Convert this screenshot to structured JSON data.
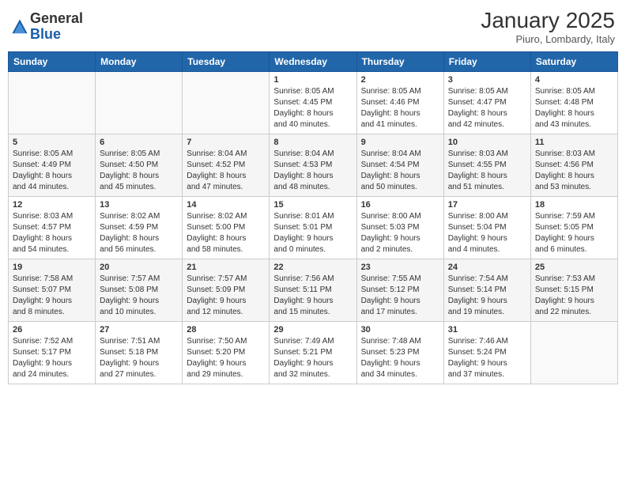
{
  "header": {
    "logo_general": "General",
    "logo_blue": "Blue",
    "month_title": "January 2025",
    "location": "Piuro, Lombardy, Italy"
  },
  "weekdays": [
    "Sunday",
    "Monday",
    "Tuesday",
    "Wednesday",
    "Thursday",
    "Friday",
    "Saturday"
  ],
  "weeks": [
    [
      {
        "day": "",
        "info": ""
      },
      {
        "day": "",
        "info": ""
      },
      {
        "day": "",
        "info": ""
      },
      {
        "day": "1",
        "info": "Sunrise: 8:05 AM\nSunset: 4:45 PM\nDaylight: 8 hours\nand 40 minutes."
      },
      {
        "day": "2",
        "info": "Sunrise: 8:05 AM\nSunset: 4:46 PM\nDaylight: 8 hours\nand 41 minutes."
      },
      {
        "day": "3",
        "info": "Sunrise: 8:05 AM\nSunset: 4:47 PM\nDaylight: 8 hours\nand 42 minutes."
      },
      {
        "day": "4",
        "info": "Sunrise: 8:05 AM\nSunset: 4:48 PM\nDaylight: 8 hours\nand 43 minutes."
      }
    ],
    [
      {
        "day": "5",
        "info": "Sunrise: 8:05 AM\nSunset: 4:49 PM\nDaylight: 8 hours\nand 44 minutes."
      },
      {
        "day": "6",
        "info": "Sunrise: 8:05 AM\nSunset: 4:50 PM\nDaylight: 8 hours\nand 45 minutes."
      },
      {
        "day": "7",
        "info": "Sunrise: 8:04 AM\nSunset: 4:52 PM\nDaylight: 8 hours\nand 47 minutes."
      },
      {
        "day": "8",
        "info": "Sunrise: 8:04 AM\nSunset: 4:53 PM\nDaylight: 8 hours\nand 48 minutes."
      },
      {
        "day": "9",
        "info": "Sunrise: 8:04 AM\nSunset: 4:54 PM\nDaylight: 8 hours\nand 50 minutes."
      },
      {
        "day": "10",
        "info": "Sunrise: 8:03 AM\nSunset: 4:55 PM\nDaylight: 8 hours\nand 51 minutes."
      },
      {
        "day": "11",
        "info": "Sunrise: 8:03 AM\nSunset: 4:56 PM\nDaylight: 8 hours\nand 53 minutes."
      }
    ],
    [
      {
        "day": "12",
        "info": "Sunrise: 8:03 AM\nSunset: 4:57 PM\nDaylight: 8 hours\nand 54 minutes."
      },
      {
        "day": "13",
        "info": "Sunrise: 8:02 AM\nSunset: 4:59 PM\nDaylight: 8 hours\nand 56 minutes."
      },
      {
        "day": "14",
        "info": "Sunrise: 8:02 AM\nSunset: 5:00 PM\nDaylight: 8 hours\nand 58 minutes."
      },
      {
        "day": "15",
        "info": "Sunrise: 8:01 AM\nSunset: 5:01 PM\nDaylight: 9 hours\nand 0 minutes."
      },
      {
        "day": "16",
        "info": "Sunrise: 8:00 AM\nSunset: 5:03 PM\nDaylight: 9 hours\nand 2 minutes."
      },
      {
        "day": "17",
        "info": "Sunrise: 8:00 AM\nSunset: 5:04 PM\nDaylight: 9 hours\nand 4 minutes."
      },
      {
        "day": "18",
        "info": "Sunrise: 7:59 AM\nSunset: 5:05 PM\nDaylight: 9 hours\nand 6 minutes."
      }
    ],
    [
      {
        "day": "19",
        "info": "Sunrise: 7:58 AM\nSunset: 5:07 PM\nDaylight: 9 hours\nand 8 minutes."
      },
      {
        "day": "20",
        "info": "Sunrise: 7:57 AM\nSunset: 5:08 PM\nDaylight: 9 hours\nand 10 minutes."
      },
      {
        "day": "21",
        "info": "Sunrise: 7:57 AM\nSunset: 5:09 PM\nDaylight: 9 hours\nand 12 minutes."
      },
      {
        "day": "22",
        "info": "Sunrise: 7:56 AM\nSunset: 5:11 PM\nDaylight: 9 hours\nand 15 minutes."
      },
      {
        "day": "23",
        "info": "Sunrise: 7:55 AM\nSunset: 5:12 PM\nDaylight: 9 hours\nand 17 minutes."
      },
      {
        "day": "24",
        "info": "Sunrise: 7:54 AM\nSunset: 5:14 PM\nDaylight: 9 hours\nand 19 minutes."
      },
      {
        "day": "25",
        "info": "Sunrise: 7:53 AM\nSunset: 5:15 PM\nDaylight: 9 hours\nand 22 minutes."
      }
    ],
    [
      {
        "day": "26",
        "info": "Sunrise: 7:52 AM\nSunset: 5:17 PM\nDaylight: 9 hours\nand 24 minutes."
      },
      {
        "day": "27",
        "info": "Sunrise: 7:51 AM\nSunset: 5:18 PM\nDaylight: 9 hours\nand 27 minutes."
      },
      {
        "day": "28",
        "info": "Sunrise: 7:50 AM\nSunset: 5:20 PM\nDaylight: 9 hours\nand 29 minutes."
      },
      {
        "day": "29",
        "info": "Sunrise: 7:49 AM\nSunset: 5:21 PM\nDaylight: 9 hours\nand 32 minutes."
      },
      {
        "day": "30",
        "info": "Sunrise: 7:48 AM\nSunset: 5:23 PM\nDaylight: 9 hours\nand 34 minutes."
      },
      {
        "day": "31",
        "info": "Sunrise: 7:46 AM\nSunset: 5:24 PM\nDaylight: 9 hours\nand 37 minutes."
      },
      {
        "day": "",
        "info": ""
      }
    ]
  ]
}
